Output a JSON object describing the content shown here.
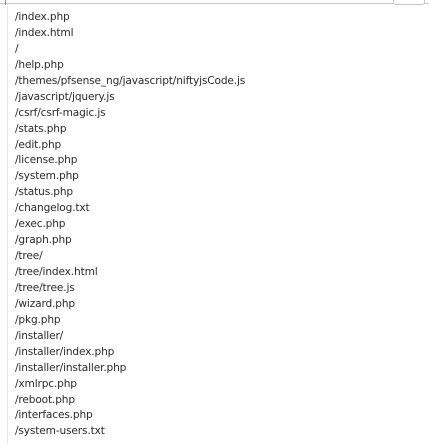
{
  "paths": [
    "/index.php",
    "/index.html",
    "/",
    "/help.php",
    "/themes/pfsense_ng/javascript/niftyjsCode.js",
    "/javascript/jquery.js",
    "/csrf/csrf-magic.js",
    "/stats.php",
    "/edit.php",
    "/license.php",
    "/system.php",
    "/status.php",
    "/changelog.txt",
    "/exec.php",
    "/graph.php",
    "/tree/",
    "/tree/index.html",
    "/tree/tree.js",
    "/wizard.php",
    "/pkg.php",
    "/installer/",
    "/installer/index.php",
    "/installer/installer.php",
    "/xmlrpc.php",
    "/reboot.php",
    "/interfaces.php",
    "/system-users.txt"
  ]
}
